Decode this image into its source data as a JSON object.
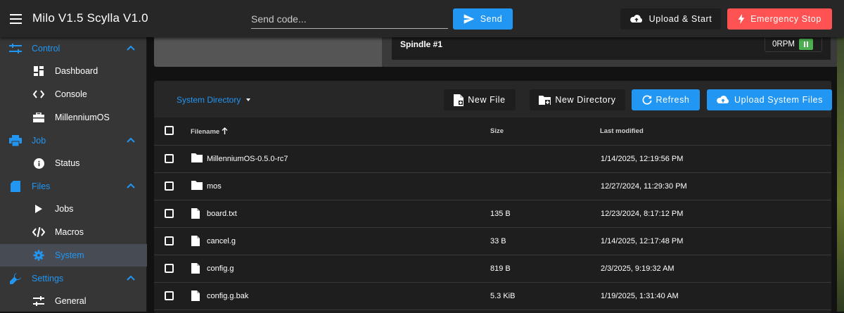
{
  "app": {
    "title": "Milo V1.5 Scylla V1.0",
    "menu_icon": "menu-icon"
  },
  "topbar": {
    "send_placeholder": "Send code...",
    "send_label": "Send",
    "upload_start_label": "Upload & Start",
    "estop_label": "Emergency Stop",
    "colors": {
      "send": "#2196f3",
      "estop": "#ff5252",
      "bar": "#272727"
    }
  },
  "sidebar": {
    "groups": [
      {
        "label": "Control",
        "icon": "sliders-icon",
        "items": [
          {
            "label": "Dashboard",
            "icon": "dashboard-icon"
          },
          {
            "label": "Console",
            "icon": "code-icon"
          },
          {
            "label": "MillenniumOS",
            "icon": "toolbox-icon"
          }
        ]
      },
      {
        "label": "Job",
        "icon": "printer-icon",
        "items": [
          {
            "label": "Status",
            "icon": "info-icon"
          }
        ]
      },
      {
        "label": "Files",
        "icon": "sd-card-icon",
        "items": [
          {
            "label": "Jobs",
            "icon": "play-icon"
          },
          {
            "label": "Macros",
            "icon": "xml-icon"
          },
          {
            "label": "System",
            "icon": "gear-icon",
            "active": true
          }
        ]
      },
      {
        "label": "Settings",
        "icon": "wrench-icon",
        "items": [
          {
            "label": "General",
            "icon": "tune-icon"
          }
        ]
      }
    ]
  },
  "spindle": {
    "label": "Spindle #1",
    "rpm": "0RPM"
  },
  "files": {
    "directory": "System Directory",
    "buttons": {
      "new_file": "New File",
      "new_directory": "New Directory",
      "refresh": "Refresh",
      "upload": "Upload System Files"
    },
    "columns": {
      "name": "Filename",
      "size": "Size",
      "modified": "Last modified"
    },
    "rows": [
      {
        "type": "folder",
        "name": "MillenniumOS-0.5.0-rc7",
        "size": "",
        "modified": "1/14/2025, 12:19:56 PM"
      },
      {
        "type": "folder",
        "name": "mos",
        "size": "",
        "modified": "12/27/2024, 11:29:30 PM"
      },
      {
        "type": "file",
        "name": "board.txt",
        "size": "135 B",
        "modified": "12/23/2024, 8:17:12 PM"
      },
      {
        "type": "file",
        "name": "cancel.g",
        "size": "33 B",
        "modified": "1/14/2025, 12:17:48 PM"
      },
      {
        "type": "file",
        "name": "config.g",
        "size": "819 B",
        "modified": "2/3/2025, 9:19:32 AM"
      },
      {
        "type": "file",
        "name": "config.g.bak",
        "size": "5.3 KiB",
        "modified": "1/19/2025, 1:31:40 AM"
      }
    ]
  }
}
